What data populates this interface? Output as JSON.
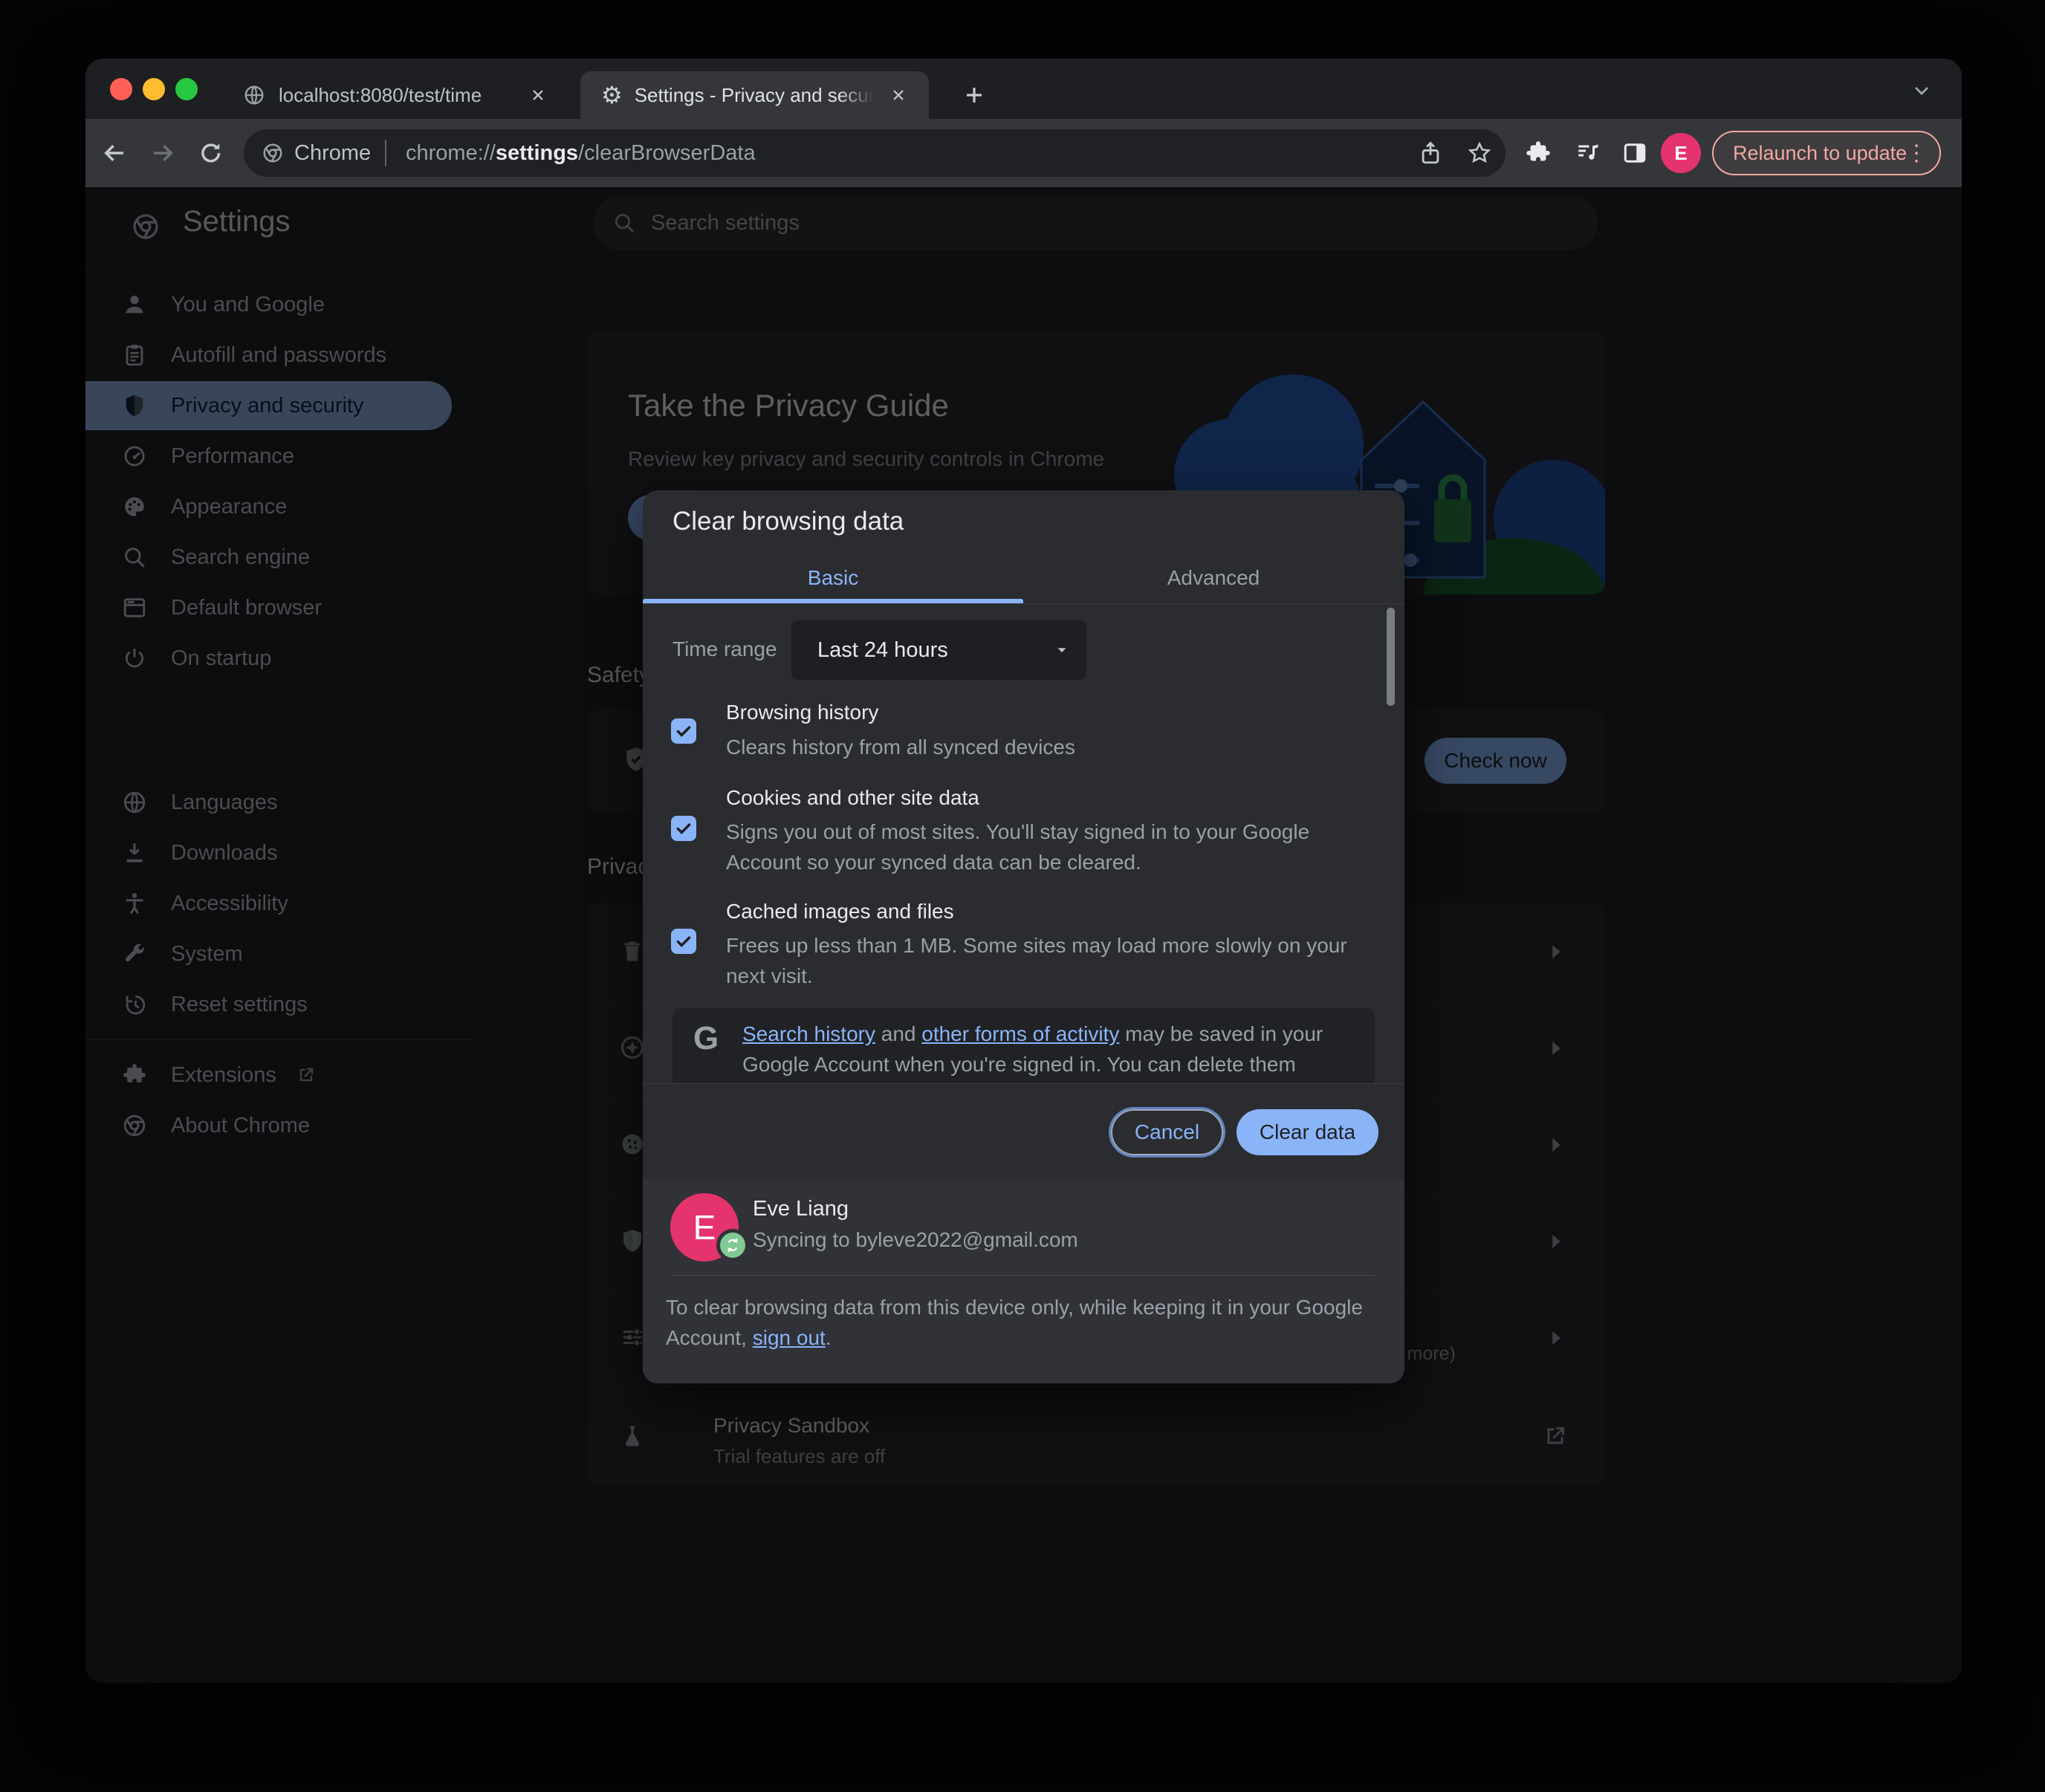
{
  "window": {
    "tabs": [
      {
        "title": "localhost:8080/test/time"
      },
      {
        "title": "Settings - Privacy and security"
      }
    ]
  },
  "toolbar": {
    "brand": "Chrome",
    "url_scheme": "chrome://",
    "url_bold": "settings",
    "url_rest": "/clearBrowserData",
    "relaunch_label": "Relaunch to update",
    "profile_initial": "E"
  },
  "settings": {
    "title": "Settings",
    "search_placeholder": "Search settings",
    "sidebar": [
      {
        "label": "You and Google",
        "icon": "person-icon"
      },
      {
        "label": "Autofill and passwords",
        "icon": "clipboard-icon"
      },
      {
        "label": "Privacy and security",
        "icon": "shield-icon",
        "selected": true
      },
      {
        "label": "Performance",
        "icon": "gauge-icon"
      },
      {
        "label": "Appearance",
        "icon": "palette-icon"
      },
      {
        "label": "Search engine",
        "icon": "search-icon"
      },
      {
        "label": "Default browser",
        "icon": "browser-icon"
      },
      {
        "label": "On startup",
        "icon": "power-icon"
      },
      {
        "label": "Languages",
        "icon": "globe-icon"
      },
      {
        "label": "Downloads",
        "icon": "download-icon"
      },
      {
        "label": "Accessibility",
        "icon": "accessibility-icon"
      },
      {
        "label": "System",
        "icon": "wrench-icon"
      },
      {
        "label": "Reset settings",
        "icon": "history-icon"
      },
      {
        "label": "Extensions",
        "icon": "puzzle-icon",
        "external": true
      },
      {
        "label": "About Chrome",
        "icon": "chrome-icon"
      }
    ],
    "privacy_guide": {
      "title": "Take the Privacy Guide",
      "subtitle": "Review key privacy and security controls in Chrome"
    },
    "safety": {
      "heading": "Safety check",
      "check_now": "Check now"
    },
    "privacy_section": {
      "heading": "Privacy and security",
      "rows": [
        {
          "icon": "trash-icon"
        },
        {
          "icon": "compass-icon"
        },
        {
          "icon": "cookie-icon"
        },
        {
          "icon": "shield-icon"
        },
        {
          "icon": "tune-icon"
        }
      ],
      "site_settings_desc": "(location, camera, pop-ups, and more)",
      "sandbox_title": "Privacy Sandbox",
      "sandbox_desc": "Trial features are off"
    }
  },
  "dialog": {
    "title": "Clear browsing data",
    "tab_basic": "Basic",
    "tab_advanced": "Advanced",
    "time_range_label": "Time range",
    "time_range_value": "Last 24 hours",
    "checkboxes": [
      {
        "title": "Browsing history",
        "desc": "Clears history from all synced devices",
        "checked": true
      },
      {
        "title": "Cookies and other site data",
        "desc": "Signs you out of most sites. You'll stay signed in to your Google Account so your synced data can be cleared.",
        "checked": true
      },
      {
        "title": "Cached images and files",
        "desc": "Frees up less than 1 MB. Some sites may load more slowly on your next visit.",
        "checked": true
      }
    ],
    "notice": {
      "logo": "G",
      "link1": "Search history",
      "mid": " and ",
      "link2": "other forms of activity",
      "tail1": " may be saved in your",
      "line2": "Google Account when you're signed in. You can delete them"
    },
    "cancel_label": "Cancel",
    "confirm_label": "Clear data",
    "account": {
      "initial": "E",
      "name": "Eve Liang",
      "status": "Syncing to byleve2022@gmail.com"
    },
    "note": {
      "line1": "To clear browsing data from this device only, while keeping it in your Google",
      "line2_pre": "Account, ",
      "link": "sign out",
      "post": "."
    }
  },
  "colors": {
    "accent_blue": "#8AB4F8",
    "relaunch_pink": "#F2A8A2",
    "avatar_pink": "#E5336E",
    "sync_green": "#81C995",
    "selected_nav": "#8FB0E0"
  }
}
